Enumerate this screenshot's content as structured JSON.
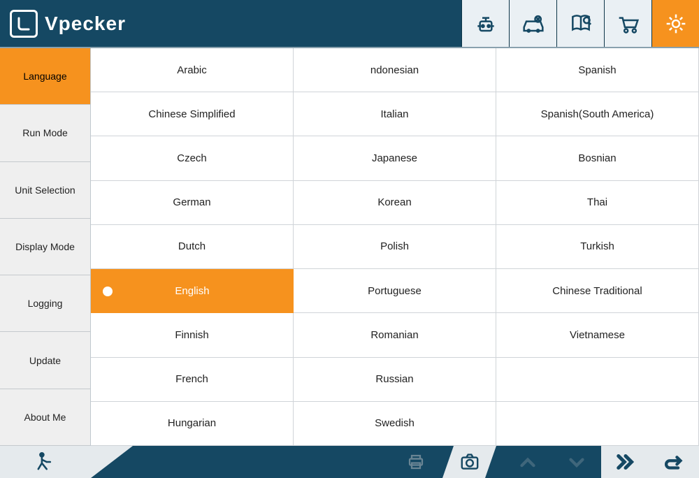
{
  "brand": {
    "name": "Vpecker"
  },
  "colors": {
    "accent": "#f6921e",
    "dark": "#154863"
  },
  "sidebar": {
    "items": [
      {
        "label": "Language",
        "active": true
      },
      {
        "label": "Run Mode",
        "active": false
      },
      {
        "label": "Unit Selection",
        "active": false
      },
      {
        "label": "Display Mode",
        "active": false
      },
      {
        "label": "Logging",
        "active": false
      },
      {
        "label": "Update",
        "active": false
      },
      {
        "label": "About Me",
        "active": false
      }
    ]
  },
  "languages": {
    "selected": "English",
    "column1": [
      "Arabic",
      "Chinese Simplified",
      "Czech",
      "German",
      "Dutch",
      "English",
      "Finnish",
      "French",
      "Hungarian"
    ],
    "column2": [
      "ndonesian",
      "Italian",
      "Japanese",
      "Korean",
      "Polish",
      "Portuguese",
      "Romanian",
      "Russian",
      "Swedish"
    ],
    "column3": [
      "Spanish",
      "Spanish(South America)",
      "Bosnian",
      "Thai",
      "Turkish",
      "Chinese Traditional",
      "Vietnamese",
      "",
      ""
    ]
  },
  "header_icons": [
    "diagnostics",
    "vehicle",
    "book",
    "cart",
    "settings"
  ],
  "footer_icons": [
    "exit",
    "print",
    "camera",
    "up",
    "down",
    "forward",
    "back"
  ]
}
